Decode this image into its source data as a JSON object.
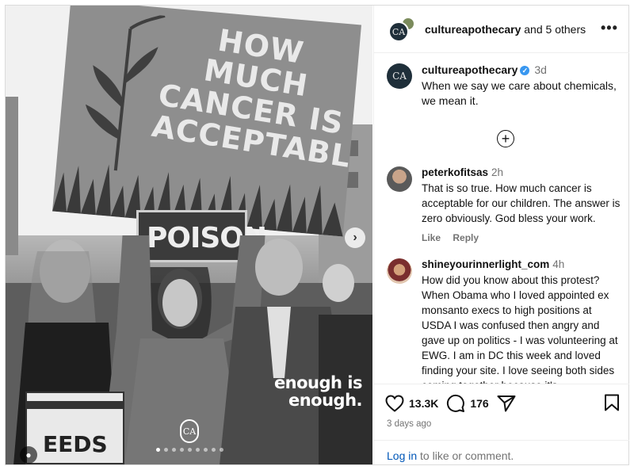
{
  "post": {
    "image": {
      "sign_text": "HOW MUCH CANCER IS ACCEPTABLE?",
      "poison_sign": "POISON",
      "overlay_text": "enough is enough.",
      "bottom_sign_text": "EEDS",
      "logo_mark": "CA",
      "carousel_dots": 9,
      "active_dot": 0
    },
    "header": {
      "username": "cultureapothecary",
      "collab_suffix": "and 5 others",
      "more_icon": "ellipsis-icon"
    },
    "caption": {
      "username": "cultureapothecary",
      "verified": true,
      "time": "3d",
      "text": "When we say we care about chemicals, we mean it."
    },
    "load_more_icon": "plus-circle-icon",
    "comments": [
      {
        "username": "peterkofitsas",
        "time": "2h",
        "text": "That is so true. How much cancer is acceptable for our children. The answer is zero obviously. God bless your work.",
        "like_label": "Like",
        "reply_label": "Reply"
      },
      {
        "username": "shineyourinnerlight_com",
        "time": "4h",
        "text": "How did you know about this protest? When Obama who I loved appointed ex monsanto execs to high positions at USDA I was confused then angry and gave up on politics - I was volunteering at EWG. I am in DC this week and loved finding your site. I love seeing both sides coming together because it's"
      }
    ],
    "actions": {
      "likes": "13.3K",
      "comments": "176",
      "posted": "3 days ago"
    },
    "login": {
      "link": "Log in",
      "rest": "to like or comment."
    }
  },
  "colors": {
    "verified": "#3897f0",
    "link": "#0057b8",
    "muted": "#737373"
  }
}
